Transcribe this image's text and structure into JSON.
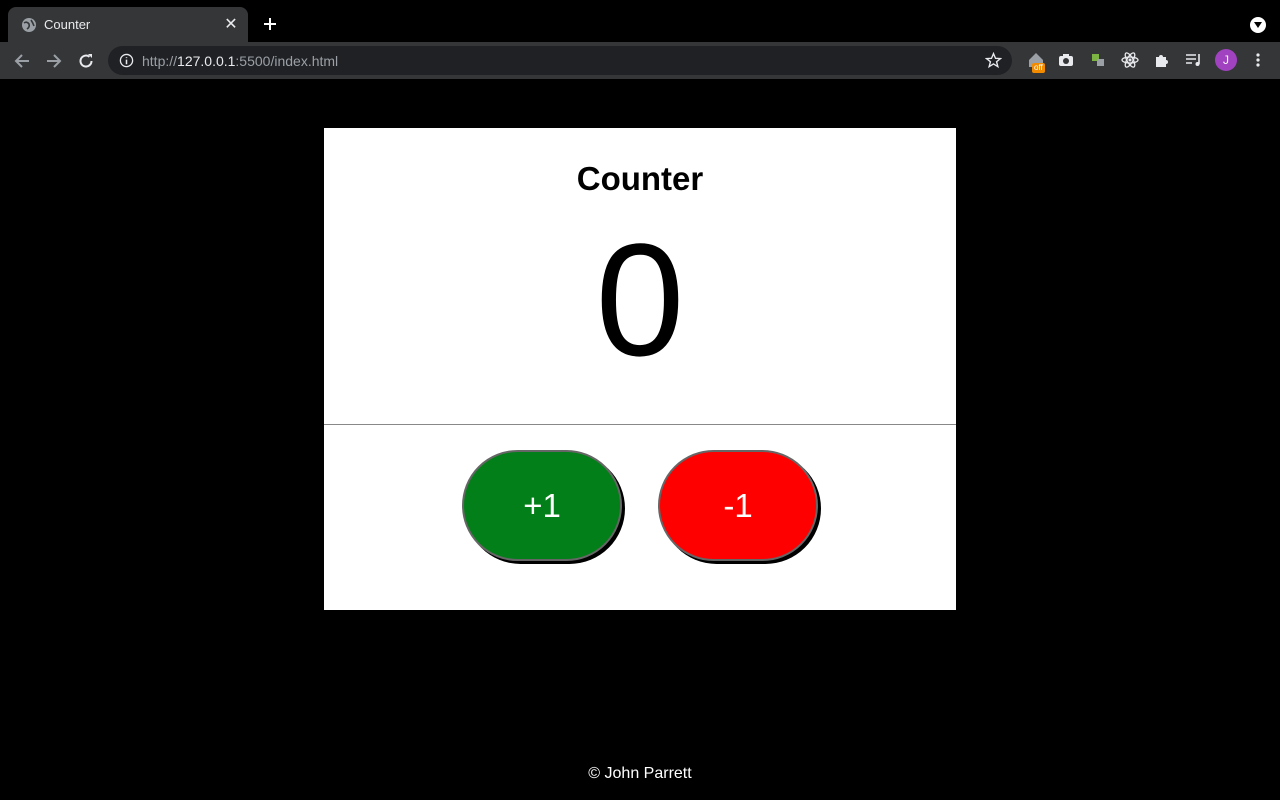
{
  "browser": {
    "tab_title": "Counter",
    "url_scheme": "http://",
    "url_host": "127.0.0.1",
    "url_rest": ":5500/index.html",
    "extension_badge": "off",
    "avatar_letter": "J"
  },
  "app": {
    "title": "Counter",
    "count": "0",
    "increment_label": "+1",
    "decrement_label": "-1",
    "increment_color": "#037f19",
    "decrement_color": "#ff0000",
    "footer": "© John Parrett"
  }
}
